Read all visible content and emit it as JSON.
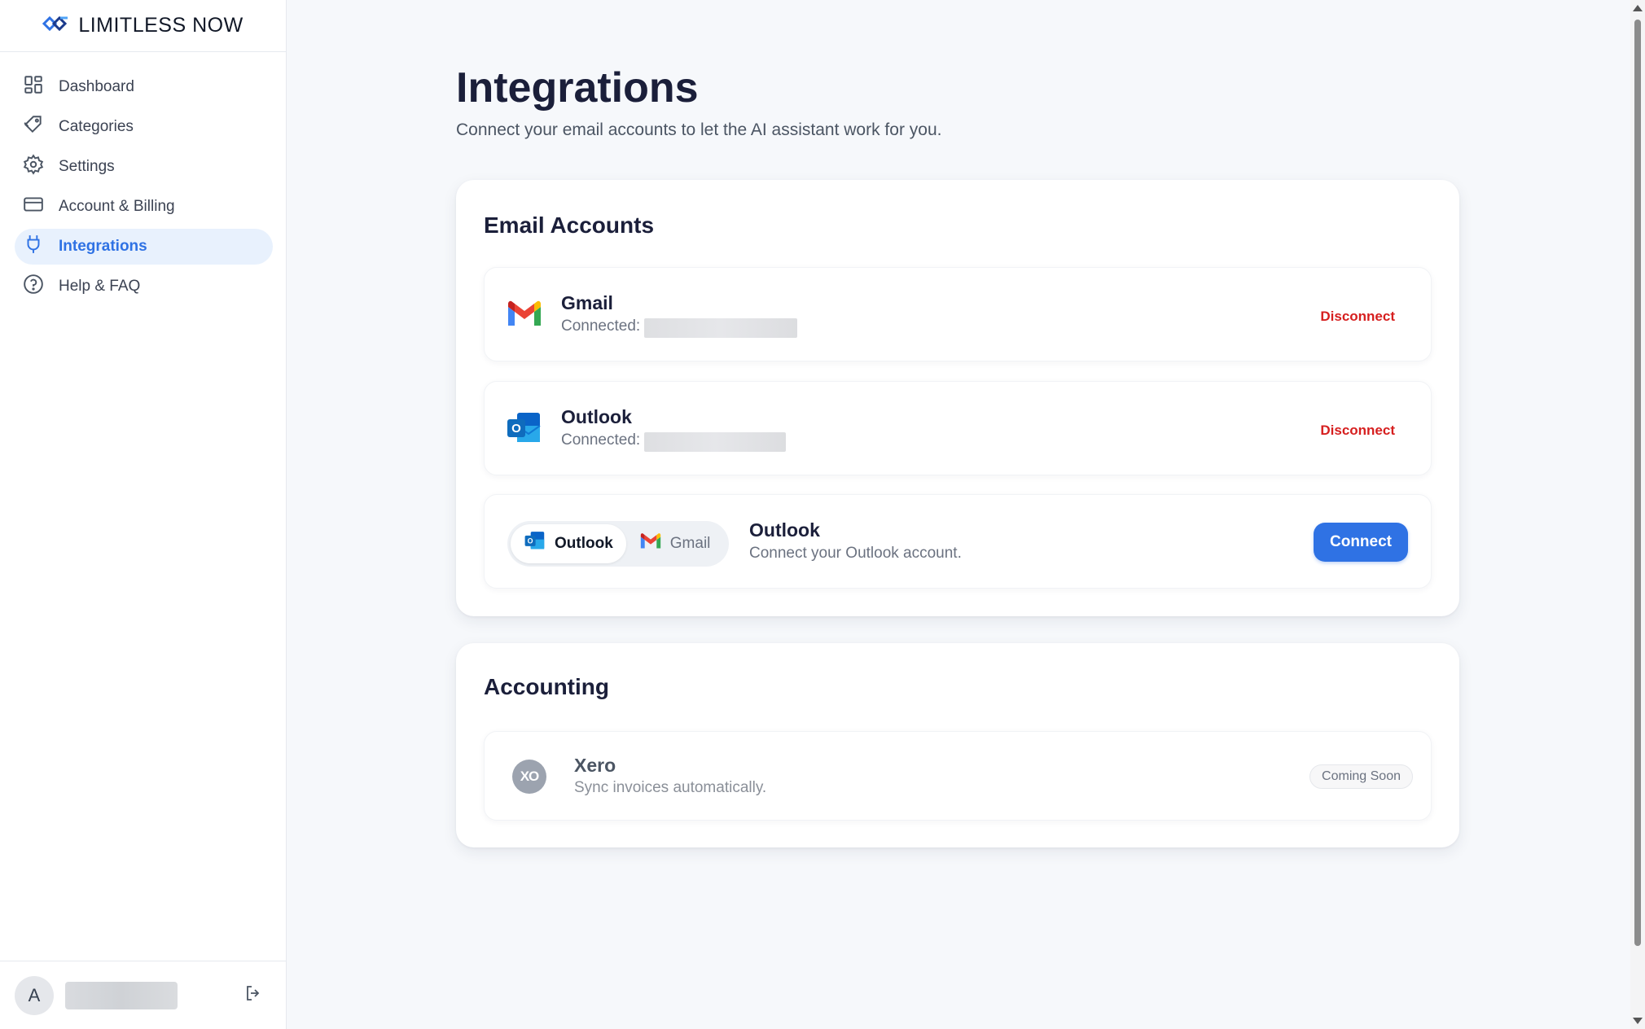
{
  "brand": {
    "name": "LIMITLESS NOW",
    "icon": "limitless-logo-icon"
  },
  "sidebar": {
    "items": [
      {
        "label": "Dashboard",
        "icon": "dashboard-grid-icon"
      },
      {
        "label": "Categories",
        "icon": "tag-icon"
      },
      {
        "label": "Settings",
        "icon": "gear-icon"
      },
      {
        "label": "Account & Billing",
        "icon": "credit-card-icon"
      },
      {
        "label": "Integrations",
        "icon": "plug-icon",
        "active": true
      },
      {
        "label": "Help & FAQ",
        "icon": "help-circle-icon"
      }
    ],
    "user": {
      "initial": "A",
      "logout_icon": "logout-icon"
    }
  },
  "page": {
    "title": "Integrations",
    "subtitle": "Connect your email accounts to let the AI assistant work for you."
  },
  "email_accounts": {
    "title": "Email Accounts",
    "connected": [
      {
        "name": "Gmail",
        "status_label": "Connected:",
        "action": "Disconnect",
        "icon": "gmail-icon"
      },
      {
        "name": "Outlook",
        "status_label": "Connected:",
        "action": "Disconnect",
        "icon": "outlook-icon"
      }
    ],
    "add": {
      "toggle": [
        {
          "label": "Outlook",
          "icon": "outlook-icon",
          "selected": true
        },
        {
          "label": "Gmail",
          "icon": "gmail-icon",
          "selected": false
        }
      ],
      "name": "Outlook",
      "description": "Connect your Outlook account.",
      "button": "Connect"
    }
  },
  "accounting": {
    "title": "Accounting",
    "items": [
      {
        "name": "Xero",
        "logo_text": "XO",
        "description": "Sync invoices automatically.",
        "badge": "Coming Soon",
        "icon": "xero-icon"
      }
    ]
  },
  "colors": {
    "accent": "#2f72e4",
    "active_nav_bg": "#e8f1fd",
    "danger": "#d61f1f",
    "background": "#f6f8fb"
  }
}
